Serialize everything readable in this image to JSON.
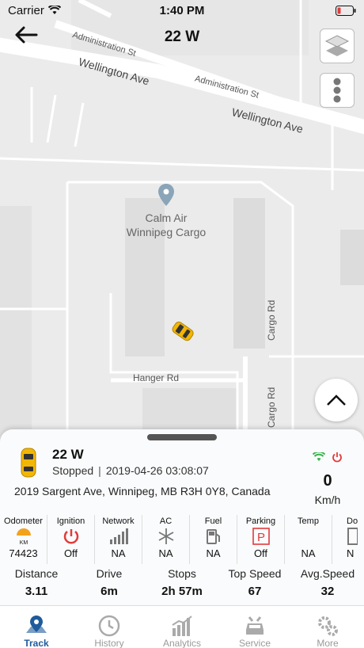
{
  "status_bar": {
    "carrier": "Carrier",
    "time": "1:40 PM"
  },
  "header": {
    "title": "22 W"
  },
  "map": {
    "streets": [
      "Administration St",
      "Wellington Ave",
      "Administration St",
      "Wellington Ave",
      "Cargo Rd",
      "Hanger Rd",
      "Cargo Rd"
    ],
    "poi": {
      "line1": "Calm Air",
      "line2": "Winnipeg Cargo"
    }
  },
  "vehicle": {
    "name": "22 W",
    "state": "Stopped",
    "separator": "|",
    "timestamp": "2019-04-26 03:08:07",
    "address": "2019 Sargent Ave, Winnipeg, MB R3H 0Y8, Canada",
    "speed": "0",
    "speed_unit": "Km/h"
  },
  "sensors": [
    {
      "label": "Odometer",
      "value": "74423",
      "icon": "odometer-icon",
      "sub": "KM"
    },
    {
      "label": "Ignition",
      "value": "Off",
      "icon": "power-icon"
    },
    {
      "label": "Network",
      "value": "NA",
      "icon": "signal-bars-icon"
    },
    {
      "label": "AC",
      "value": "NA",
      "icon": "snowflake-icon"
    },
    {
      "label": "Fuel",
      "value": "NA",
      "icon": "fuel-pump-icon"
    },
    {
      "label": "Parking",
      "value": "Off",
      "icon": "parking-icon",
      "glyph": "P"
    },
    {
      "label": "Temp",
      "value": "NA",
      "icon": "thermometer-icon"
    },
    {
      "label": "Do",
      "value": "N",
      "icon": "door-icon"
    }
  ],
  "stats": [
    {
      "label": "Distance",
      "value": "3.11"
    },
    {
      "label": "Drive",
      "value": "6m"
    },
    {
      "label": "Stops",
      "value": "2h 57m"
    },
    {
      "label": "Top Speed",
      "value": "67"
    },
    {
      "label": "Avg.Speed",
      "value": "32"
    }
  ],
  "tabs": [
    {
      "label": "Track",
      "icon": "map-pin-icon",
      "active": true
    },
    {
      "label": "History",
      "icon": "clock-icon",
      "active": false
    },
    {
      "label": "Analytics",
      "icon": "bar-chart-icon",
      "active": false
    },
    {
      "label": "Service",
      "icon": "car-service-icon",
      "active": false
    },
    {
      "label": "More",
      "icon": "gears-icon",
      "active": false
    }
  ],
  "colors": {
    "accent": "#1f5b9c",
    "power_red": "#e23b3b",
    "wifi_green": "#37b34a",
    "car_yellow": "#f2b705"
  }
}
